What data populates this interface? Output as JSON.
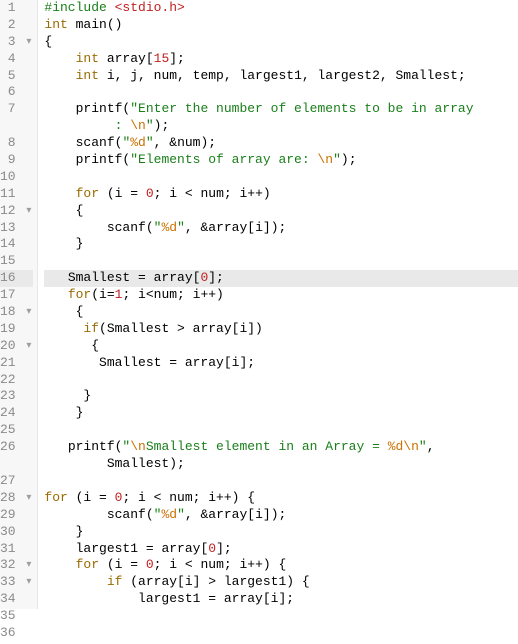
{
  "editor": {
    "highlight_line": 16,
    "lines": [
      {
        "n": 1,
        "fold": false,
        "indent": 0,
        "segs": [
          {
            "c": "tok-pp",
            "t": "#include "
          },
          {
            "c": "tok-inc",
            "t": "<stdio.h>"
          }
        ]
      },
      {
        "n": 2,
        "fold": false,
        "indent": 0,
        "segs": [
          {
            "c": "tok-kw",
            "t": "int"
          },
          {
            "c": "tok-id",
            "t": " main()"
          }
        ]
      },
      {
        "n": 3,
        "fold": true,
        "indent": 0,
        "segs": [
          {
            "c": "tok-punc",
            "t": "{"
          }
        ]
      },
      {
        "n": 4,
        "fold": false,
        "indent": 4,
        "segs": [
          {
            "c": "tok-kw",
            "t": "int"
          },
          {
            "c": "tok-id",
            "t": " array["
          },
          {
            "c": "tok-num",
            "t": "15"
          },
          {
            "c": "tok-id",
            "t": "];"
          }
        ]
      },
      {
        "n": 5,
        "fold": false,
        "indent": 4,
        "segs": [
          {
            "c": "tok-kw",
            "t": "int"
          },
          {
            "c": "tok-id",
            "t": " i, j, num, temp, largest1, largest2, Smallest;"
          }
        ]
      },
      {
        "n": 6,
        "fold": false,
        "indent": 0,
        "segs": []
      },
      {
        "n": 7,
        "fold": false,
        "indent": 4,
        "segs": [
          {
            "c": "tok-id",
            "t": "printf("
          },
          {
            "c": "tok-str",
            "t": "\"Enter the number of elements to be in array"
          }
        ]
      },
      {
        "n": "",
        "fold": false,
        "indent": 8,
        "segs": [
          {
            "c": "tok-str",
            "t": " : "
          },
          {
            "c": "tok-esc",
            "t": "\\n"
          },
          {
            "c": "tok-str",
            "t": "\""
          },
          {
            "c": "tok-id",
            "t": ");"
          }
        ]
      },
      {
        "n": 8,
        "fold": false,
        "indent": 4,
        "segs": [
          {
            "c": "tok-id",
            "t": "scanf("
          },
          {
            "c": "tok-str",
            "t": "\""
          },
          {
            "c": "tok-esc",
            "t": "%d"
          },
          {
            "c": "tok-str",
            "t": "\""
          },
          {
            "c": "tok-id",
            "t": ", &num);"
          }
        ]
      },
      {
        "n": 9,
        "fold": false,
        "indent": 4,
        "segs": [
          {
            "c": "tok-id",
            "t": "printf("
          },
          {
            "c": "tok-str",
            "t": "\"Elements of array are: "
          },
          {
            "c": "tok-esc",
            "t": "\\n"
          },
          {
            "c": "tok-str",
            "t": "\""
          },
          {
            "c": "tok-id",
            "t": ");"
          }
        ]
      },
      {
        "n": 10,
        "fold": false,
        "indent": 0,
        "segs": []
      },
      {
        "n": 11,
        "fold": false,
        "indent": 4,
        "segs": [
          {
            "c": "tok-kw",
            "t": "for"
          },
          {
            "c": "tok-id",
            "t": " (i = "
          },
          {
            "c": "tok-num",
            "t": "0"
          },
          {
            "c": "tok-id",
            "t": "; i < num; i++)"
          }
        ]
      },
      {
        "n": 12,
        "fold": true,
        "indent": 4,
        "segs": [
          {
            "c": "tok-punc",
            "t": "{"
          }
        ]
      },
      {
        "n": 13,
        "fold": false,
        "indent": 8,
        "segs": [
          {
            "c": "tok-id",
            "t": "scanf("
          },
          {
            "c": "tok-str",
            "t": "\""
          },
          {
            "c": "tok-esc",
            "t": "%d"
          },
          {
            "c": "tok-str",
            "t": "\""
          },
          {
            "c": "tok-id",
            "t": ", &array[i]);"
          }
        ]
      },
      {
        "n": 14,
        "fold": false,
        "indent": 4,
        "segs": [
          {
            "c": "tok-punc",
            "t": "}"
          }
        ]
      },
      {
        "n": 15,
        "fold": false,
        "indent": 0,
        "segs": []
      },
      {
        "n": 16,
        "fold": false,
        "indent": 3,
        "segs": [
          {
            "c": "tok-id",
            "t": "Smallest = array["
          },
          {
            "c": "tok-num",
            "t": "0"
          },
          {
            "c": "tok-id",
            "t": "];"
          }
        ]
      },
      {
        "n": 17,
        "fold": false,
        "indent": 3,
        "segs": [
          {
            "c": "tok-kw",
            "t": "for"
          },
          {
            "c": "tok-id",
            "t": "(i="
          },
          {
            "c": "tok-num",
            "t": "1"
          },
          {
            "c": "tok-id",
            "t": "; i<num; i++)"
          }
        ]
      },
      {
        "n": 18,
        "fold": true,
        "indent": 4,
        "segs": [
          {
            "c": "tok-punc",
            "t": "{"
          }
        ]
      },
      {
        "n": 19,
        "fold": false,
        "indent": 5,
        "segs": [
          {
            "c": "tok-kw",
            "t": "if"
          },
          {
            "c": "tok-id",
            "t": "(Smallest > array[i])"
          }
        ]
      },
      {
        "n": 20,
        "fold": true,
        "indent": 6,
        "segs": [
          {
            "c": "tok-punc",
            "t": "{"
          }
        ]
      },
      {
        "n": 21,
        "fold": false,
        "indent": 7,
        "segs": [
          {
            "c": "tok-id",
            "t": "Smallest = array[i];"
          }
        ]
      },
      {
        "n": 22,
        "fold": false,
        "indent": 0,
        "segs": []
      },
      {
        "n": 23,
        "fold": false,
        "indent": 5,
        "segs": [
          {
            "c": "tok-punc",
            "t": "}"
          }
        ]
      },
      {
        "n": 24,
        "fold": false,
        "indent": 4,
        "segs": [
          {
            "c": "tok-punc",
            "t": "}"
          }
        ]
      },
      {
        "n": 25,
        "fold": false,
        "indent": 0,
        "segs": []
      },
      {
        "n": 26,
        "fold": false,
        "indent": 3,
        "segs": [
          {
            "c": "tok-id",
            "t": "printf("
          },
          {
            "c": "tok-str",
            "t": "\""
          },
          {
            "c": "tok-esc",
            "t": "\\n"
          },
          {
            "c": "tok-str",
            "t": "Smallest element in an Array = "
          },
          {
            "c": "tok-esc",
            "t": "%d"
          },
          {
            "c": "tok-esc",
            "t": "\\n"
          },
          {
            "c": "tok-str",
            "t": "\""
          },
          {
            "c": "tok-id",
            "t": ", "
          }
        ]
      },
      {
        "n": "",
        "fold": false,
        "indent": 8,
        "segs": [
          {
            "c": "tok-id",
            "t": "Smallest);"
          }
        ]
      },
      {
        "n": 27,
        "fold": false,
        "indent": 0,
        "segs": []
      },
      {
        "n": 28,
        "fold": true,
        "indent": 0,
        "segs": [
          {
            "c": "tok-kw",
            "t": "for"
          },
          {
            "c": "tok-id",
            "t": " (i = "
          },
          {
            "c": "tok-num",
            "t": "0"
          },
          {
            "c": "tok-id",
            "t": "; i < num; i++) {"
          }
        ]
      },
      {
        "n": 29,
        "fold": false,
        "indent": 8,
        "segs": [
          {
            "c": "tok-id",
            "t": "scanf("
          },
          {
            "c": "tok-str",
            "t": "\""
          },
          {
            "c": "tok-esc",
            "t": "%d"
          },
          {
            "c": "tok-str",
            "t": "\""
          },
          {
            "c": "tok-id",
            "t": ", &array[i]);"
          }
        ]
      },
      {
        "n": 30,
        "fold": false,
        "indent": 4,
        "segs": [
          {
            "c": "tok-punc",
            "t": "}"
          }
        ]
      },
      {
        "n": 31,
        "fold": false,
        "indent": 4,
        "segs": [
          {
            "c": "tok-id",
            "t": "largest1 = array["
          },
          {
            "c": "tok-num",
            "t": "0"
          },
          {
            "c": "tok-id",
            "t": "];"
          }
        ]
      },
      {
        "n": 32,
        "fold": true,
        "indent": 4,
        "segs": [
          {
            "c": "tok-kw",
            "t": "for"
          },
          {
            "c": "tok-id",
            "t": " (i = "
          },
          {
            "c": "tok-num",
            "t": "0"
          },
          {
            "c": "tok-id",
            "t": "; i < num; i++) {"
          }
        ]
      },
      {
        "n": 33,
        "fold": true,
        "indent": 8,
        "segs": [
          {
            "c": "tok-kw",
            "t": "if"
          },
          {
            "c": "tok-id",
            "t": " (array[i] > largest1) {"
          }
        ]
      },
      {
        "n": 34,
        "fold": false,
        "indent": 12,
        "segs": [
          {
            "c": "tok-id",
            "t": "largest1 = array[i];"
          }
        ]
      },
      {
        "n": 35,
        "fold": false,
        "indent": 8,
        "segs": [
          {
            "c": "tok-punc",
            "t": "}"
          }
        ]
      },
      {
        "n": 36,
        "fold": false,
        "indent": 4,
        "segs": [
          {
            "c": "tok-punc",
            "t": "}"
          }
        ]
      }
    ]
  }
}
